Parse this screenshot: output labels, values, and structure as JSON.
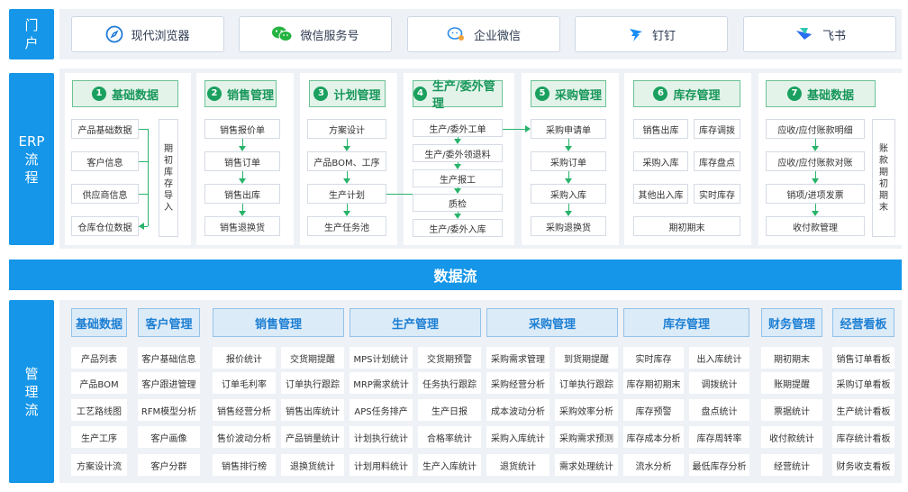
{
  "portal": {
    "label": "门\n户",
    "items": [
      {
        "label": "现代浏览器",
        "icon": "compass-icon",
        "icon_color": "#1f7bd8"
      },
      {
        "label": "微信服务号",
        "icon": "wechat-icon",
        "icon_color": "#24b33f"
      },
      {
        "label": "企业微信",
        "icon": "wecom-icon",
        "icon_color": "#2a8be6"
      },
      {
        "label": "钉钉",
        "icon": "dingtalk-icon",
        "icon_color": "#1a8cf5"
      },
      {
        "label": "飞书",
        "icon": "feishu-icon",
        "icon_color": "#2a6cf0"
      }
    ]
  },
  "erp": {
    "label": "ERP\n流\n程",
    "c1": {
      "num": "1",
      "title": "基础数据",
      "items": [
        "产品基础数据",
        "客户信息",
        "供应商信息",
        "仓库仓位数据"
      ],
      "side": "期\n初\n库\n存\n导\n入"
    },
    "c2": {
      "num": "2",
      "title": "销售管理",
      "items": [
        "销售报价单",
        "销售订单",
        "销售出库",
        "销售退换货"
      ]
    },
    "c3": {
      "num": "3",
      "title": "计划管理",
      "items": [
        "方案设计",
        "产品BOM、工序",
        "生产计划",
        "生产任务池"
      ]
    },
    "c4": {
      "num": "4",
      "title": "生产/委外管理",
      "items": [
        "生产/委外工单",
        "生产/委外领退料",
        "生产报工",
        "质检",
        "生产/委外入库"
      ]
    },
    "c5": {
      "num": "5",
      "title": "采购管理",
      "items": [
        "采购申请单",
        "采购订单",
        "采购入库",
        "采购退换货"
      ]
    },
    "c6": {
      "num": "6",
      "title": "库存管理",
      "items": [
        "销售出库",
        "库存调拨",
        "采购入库",
        "库存盘点",
        "其他出入库",
        "实时库存",
        "期初期末"
      ]
    },
    "c7": {
      "num": "7",
      "title": "基础数据",
      "items": [
        "应收/应付账款明细",
        "应收/应付账款对账",
        "销项/进项发票",
        "收付款管理"
      ],
      "side": "账\n款\n期\n初\n期\n末"
    }
  },
  "dataflow": "数据流",
  "mgmt": {
    "label": "管\n理\n流",
    "groups": [
      {
        "title": "基础数据",
        "items": [
          "产品列表",
          "产品BOM",
          "工艺路线图",
          "生产工序",
          "方案设计流"
        ]
      },
      {
        "title": "客户管理",
        "items": [
          "客户基础信息",
          "客户跟进管理",
          "RFM模型分析",
          "客户画像",
          "客户分群"
        ]
      },
      {
        "title": "销售管理",
        "items": [
          "报价统计",
          "交货期提醒",
          "订单毛利率",
          "订单执行跟踪",
          "销售经营分析",
          "销售出库统计",
          "售价波动分析",
          "产品销量统计",
          "销售排行榜",
          "退换货统计"
        ]
      },
      {
        "title": "生产管理",
        "items": [
          "MPS计划统计",
          "交货期预警",
          "MRP需求统计",
          "任务执行跟踪",
          "APS任务排产",
          "生产日报",
          "计划执行统计",
          "合格率统计",
          "计划用料统计",
          "生产入库统计"
        ]
      },
      {
        "title": "采购管理",
        "items": [
          "采购需求管理",
          "到货期提醒",
          "采购经营分析",
          "订单执行跟踪",
          "成本波动分析",
          "采购效率分析",
          "采购入库统计",
          "采购需求预测",
          "退货统计",
          "需求处理统计"
        ]
      },
      {
        "title": "库存管理",
        "items": [
          "实时库存",
          "出入库统计",
          "库存期初期末",
          "调拨统计",
          "库存预警",
          "盘点统计",
          "库存成本分析",
          "库存周转率",
          "流水分析",
          "最低库存分析"
        ]
      },
      {
        "title": "财务管理",
        "items": [
          "期初期末",
          "账期提醒",
          "票据统计",
          "收付款统计",
          "经营统计"
        ]
      },
      {
        "title": "经营看板",
        "items": [
          "销售订单看板",
          "采购订单看板",
          "生产统计看板",
          "库存统计看板",
          "财务收支看板"
        ]
      }
    ]
  },
  "colors": {
    "blue": "#1596e8",
    "green": "#1aa05f",
    "panel": "#eef1f6",
    "head": "#1c7fd3"
  }
}
